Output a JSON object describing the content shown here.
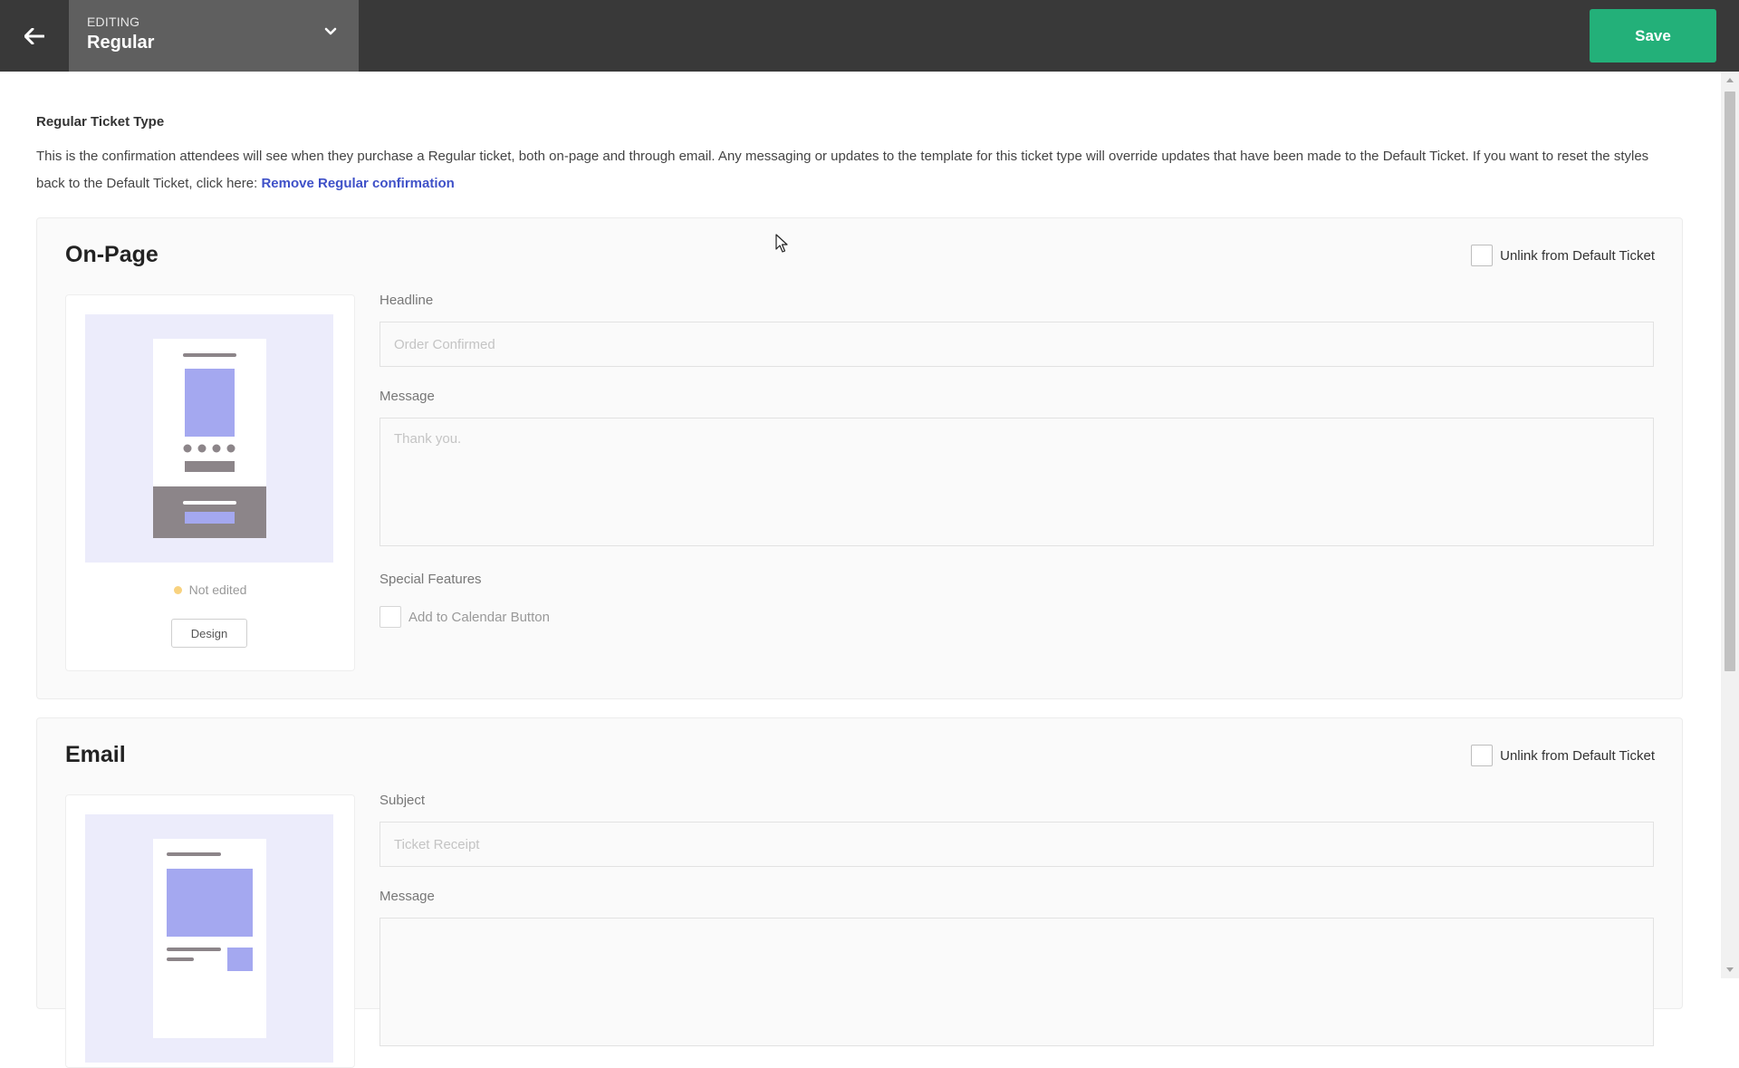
{
  "topbar": {
    "editing_label": "EDITING",
    "ticket_name": "Regular",
    "save_label": "Save",
    "accent_color": "#23b079"
  },
  "intro": {
    "heading": "Regular Ticket Type",
    "description": "This is the confirmation attendees will see when they purchase a Regular ticket, both on-page and through email. Any messaging or updates to the template for this ticket type will override updates that have been made to the Default Ticket. If you want to reset the styles back to the Default Ticket, click here: ",
    "remove_link": "Remove Regular confirmation"
  },
  "onpage": {
    "title": "On-Page",
    "unlink_label": "Unlink from Default Ticket",
    "status": "Not edited",
    "design_label": "Design",
    "headline_label": "Headline",
    "headline_placeholder": "Order Confirmed",
    "message_label": "Message",
    "message_placeholder": "Thank you.",
    "features_label": "Special Features",
    "calendar_label": "Add to Calendar Button"
  },
  "email": {
    "title": "Email",
    "unlink_label": "Unlink from Default Ticket",
    "subject_label": "Subject",
    "subject_placeholder": "Ticket Receipt",
    "message_label": "Message"
  },
  "icons": {
    "back": "arrow-left-icon",
    "dropdown": "chevron-down-icon",
    "cursor": "mouse-pointer-icon"
  }
}
